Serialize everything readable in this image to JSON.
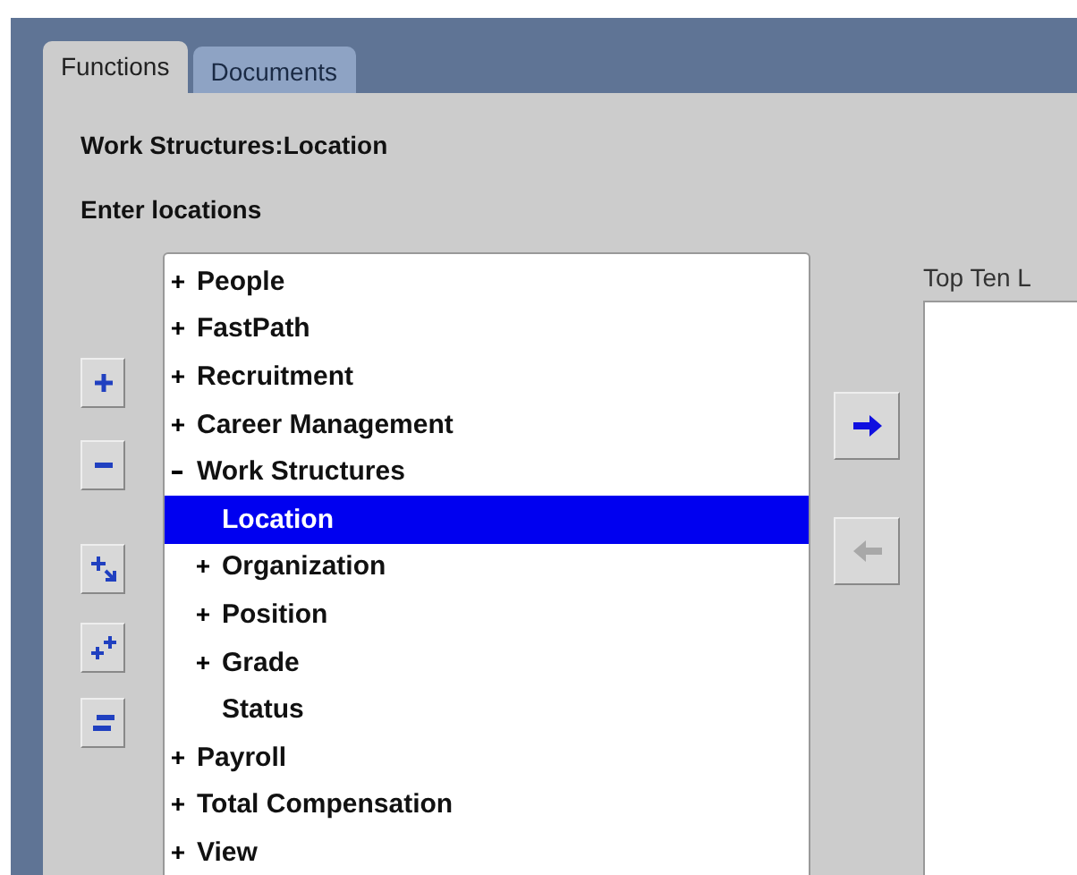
{
  "tabs": [
    {
      "label": "Functions",
      "selected": true
    },
    {
      "label": "Documents",
      "selected": false
    }
  ],
  "page_title": "Work Structures:Location",
  "instruction": "Enter locations",
  "tree_buttons": [
    {
      "kind": "expand"
    },
    {
      "kind": "collapse"
    },
    {
      "kind": "focus"
    },
    {
      "kind": "expand_all"
    },
    {
      "kind": "collapse_all"
    }
  ],
  "tree": [
    {
      "label": "People",
      "kind": "node",
      "expanded": false,
      "selected": false
    },
    {
      "label": "FastPath",
      "kind": "node",
      "expanded": false,
      "selected": false
    },
    {
      "label": "Recruitment",
      "kind": "node",
      "expanded": false,
      "selected": false
    },
    {
      "label": "Career Management",
      "kind": "node",
      "expanded": false,
      "selected": false
    },
    {
      "label": "Work Structures",
      "kind": "node",
      "expanded": true,
      "selected": false,
      "children": [
        {
          "label": "Location",
          "kind": "leaf",
          "expanded": false,
          "selected": true
        },
        {
          "label": "Organization",
          "kind": "node",
          "expanded": false,
          "selected": false
        },
        {
          "label": "Position",
          "kind": "node",
          "expanded": false,
          "selected": false
        },
        {
          "label": "Grade",
          "kind": "node",
          "expanded": false,
          "selected": false
        },
        {
          "label": "Status",
          "kind": "leaf",
          "expanded": false,
          "selected": false
        }
      ]
    },
    {
      "label": "Payroll",
      "kind": "node",
      "expanded": false,
      "selected": false
    },
    {
      "label": "Total Compensation",
      "kind": "node",
      "expanded": false,
      "selected": false
    },
    {
      "label": "View",
      "kind": "node",
      "expanded": false,
      "selected": false
    }
  ],
  "move_buttons": [
    {
      "kind": "add",
      "disabled": false
    },
    {
      "kind": "remove",
      "disabled": true
    }
  ],
  "top_ten": {
    "label": "Top Ten L"
  }
}
